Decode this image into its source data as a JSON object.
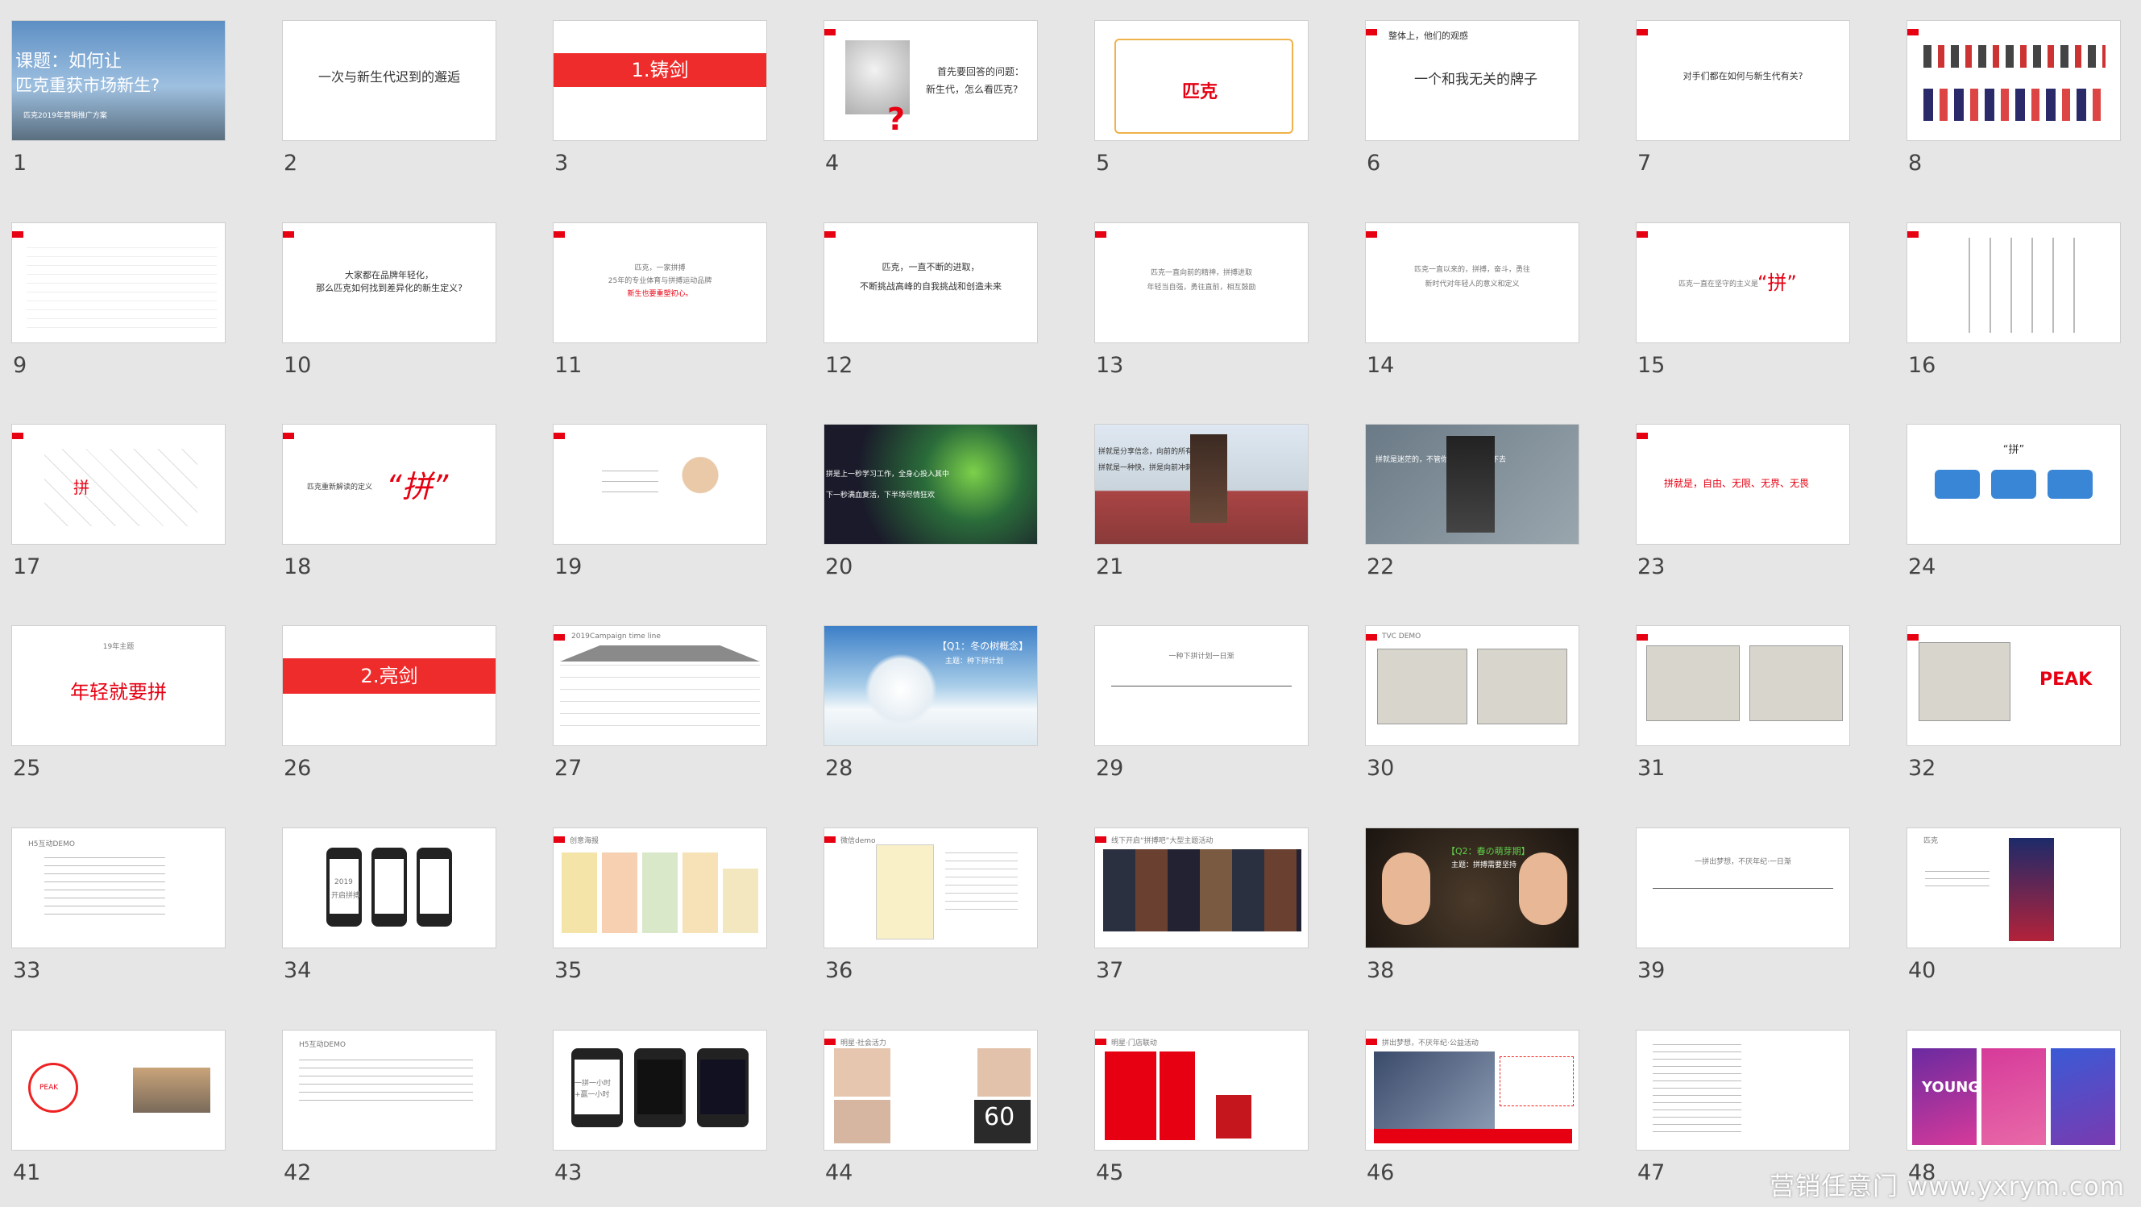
{
  "watermark": "营销任意门 www.yxrym.com",
  "slides": [
    {
      "num": "1",
      "title": "课题：如何让",
      "subtitle": "匹克重获市场新生?",
      "caption": "匹克2019年营销推广方案"
    },
    {
      "num": "2",
      "text": "一次与新生代迟到的邂逅"
    },
    {
      "num": "3",
      "text": "1.铸剑"
    },
    {
      "num": "4",
      "text": "首先要回答的问题：",
      "text2": "新生代，怎么看匹克?"
    },
    {
      "num": "5",
      "text": "匹克"
    },
    {
      "num": "6",
      "text": "整体上，他们的观感",
      "quote": "一个和我无关的牌子"
    },
    {
      "num": "7",
      "text": "对手们都在如何与新生代有关?"
    },
    {
      "num": "8"
    },
    {
      "num": "9"
    },
    {
      "num": "10",
      "text": "大家都在品牌年轻化，",
      "text2": "那么匹克如何找到差异化的新生定义?"
    },
    {
      "num": "11",
      "text": "匹克，一家拼搏",
      "text2": "25年的专业体育与拼搏运动品牌",
      "text3": "新生也要重塑初心。"
    },
    {
      "num": "12",
      "text": "匹克，一直不断的进取，",
      "text2": "不断挑战高峰的自我挑战和创造未来"
    },
    {
      "num": "13",
      "text": "匹克一直向前的精神，拼搏进取",
      "text2": "年轻当自强，勇往直前，相互鼓励"
    },
    {
      "num": "14",
      "text": "匹克一直以来的，拼搏，奋斗，勇往",
      "text2": "新时代对年轻人的意义和定义"
    },
    {
      "num": "15",
      "text": "匹克一直在坚守的主义是",
      "quote": "“拼”"
    },
    {
      "num": "16"
    },
    {
      "num": "17",
      "text": "拼"
    },
    {
      "num": "18",
      "text": "匹克重新解读的定义",
      "quote": "“拼”"
    },
    {
      "num": "19"
    },
    {
      "num": "20",
      "text": "拼是上一秒学习工作，全身心投入其中",
      "text2": "下一秒满血复活，下半场尽情狂欢"
    },
    {
      "num": "21",
      "text": "拼就是分享信念，向前的所有努力",
      "text2": "拼就是一种快，拼是向前冲刺"
    },
    {
      "num": "22",
      "text": "拼就是迷茫的，不管你怎样失败和走下去"
    },
    {
      "num": "23",
      "text": "拼就是，自由、无限、无界、无畏"
    },
    {
      "num": "24",
      "quote": "“拼”"
    },
    {
      "num": "25",
      "text": "19年主题",
      "text2": "年轻就要拼"
    },
    {
      "num": "26",
      "text": "2.亮剑"
    },
    {
      "num": "27",
      "text": "2019Campaign time line"
    },
    {
      "num": "28",
      "text": "【Q1：冬の树概念】",
      "text2": "主题：种下拼计划"
    },
    {
      "num": "29",
      "text": "一种下拼计划一日渐"
    },
    {
      "num": "30",
      "text": "TVC DEMO"
    },
    {
      "num": "31"
    },
    {
      "num": "32",
      "text": "PEAK"
    },
    {
      "num": "33",
      "text": "H5互动DEMO"
    },
    {
      "num": "34",
      "text": "2019",
      "text2": "开启拼搏"
    },
    {
      "num": "35",
      "text": "创意海报"
    },
    {
      "num": "36",
      "text": "微信demo"
    },
    {
      "num": "37",
      "text": "线下开启“拼搏吧”大型主题活动"
    },
    {
      "num": "38",
      "text": "【Q2：春の萌芽期】",
      "text2": "主题：拼搏需要坚持"
    },
    {
      "num": "39",
      "text": "一拼出梦想，不厌年纪·一日渐"
    },
    {
      "num": "40",
      "text": "匹克"
    },
    {
      "num": "41",
      "text": "PEAK"
    },
    {
      "num": "42",
      "text": "H5互动DEMO"
    },
    {
      "num": "43",
      "text": "一拼一小时",
      "text2": "+赢一小时"
    },
    {
      "num": "44",
      "text": "明星·社会活力",
      "text3": "60"
    },
    {
      "num": "45",
      "text": "明星·门店联动"
    },
    {
      "num": "46",
      "text": "拼出梦想，不厌年纪·公益活动"
    },
    {
      "num": "47"
    },
    {
      "num": "48",
      "text": "YOUNG"
    }
  ]
}
